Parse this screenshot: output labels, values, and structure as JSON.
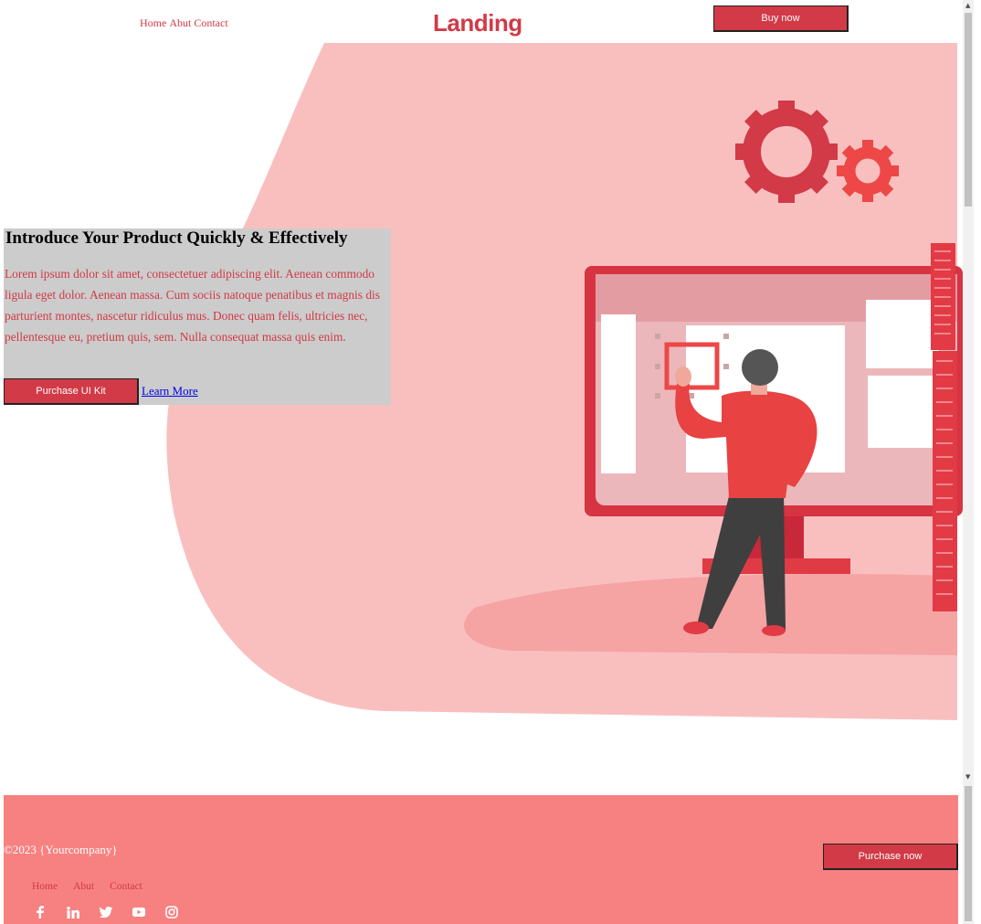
{
  "header": {
    "nav": [
      "Home",
      "Abut",
      "Contact"
    ],
    "logo": "Landing",
    "buy_button": "Buy now"
  },
  "hero": {
    "title": "Introduce Your Product Quickly & Effectively",
    "body": "Lorem ipsum dolor sit amet, consectetuer adipiscing elit. Aenean commodo ligula eget dolor. Aenean massa. Cum sociis natoque penatibus et magnis dis parturient montes, nascetur ridiculus mus. Donec quam felis, ultricies nec, pellentesque eu, pretium quis, sem. Nulla consequat massa quis enim.",
    "primary_button": "Purchase UI Kit",
    "secondary_link": "Learn More"
  },
  "footer": {
    "copyright": "©2023 {Yourcompany}",
    "purchase_button": "Purchase now",
    "links": [
      "Home",
      "Abut",
      "Contact"
    ],
    "social_icons": [
      "facebook-icon",
      "linkedin-icon",
      "twitter-icon",
      "youtube-icon",
      "instagram-icon"
    ]
  },
  "colors": {
    "accent": "#d13a46",
    "hero_blob": "#f9bfbf",
    "footer_bg": "#f78180",
    "intro_box_bg": "#cccccc"
  }
}
